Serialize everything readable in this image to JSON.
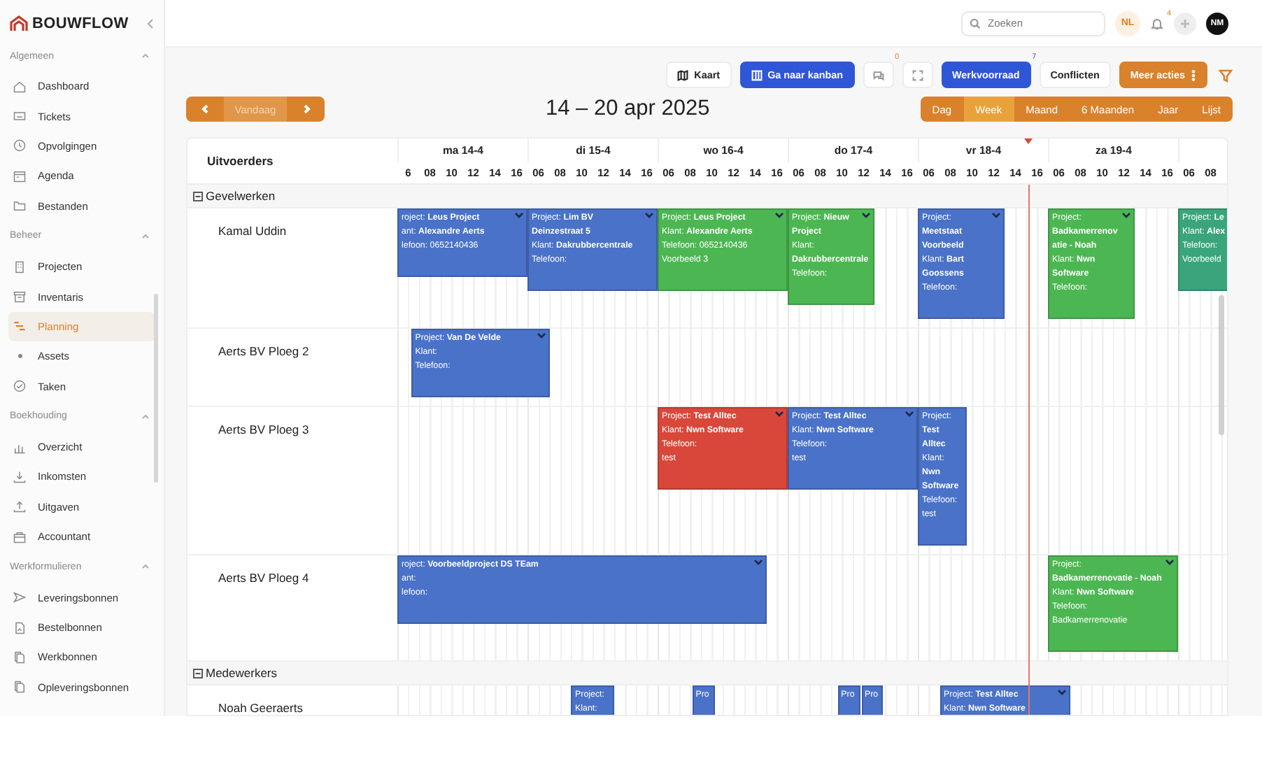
{
  "sidebar": {
    "brand": "BOUWFLOW",
    "sections": [
      {
        "title": "Algemeen",
        "expanded": true,
        "items": [
          {
            "label": "Dashboard",
            "kind": "page",
            "selected": false
          },
          {
            "label": "Tickets",
            "kind": "page",
            "selected": false
          },
          {
            "label": "Opvolgingen",
            "kind": "page",
            "selected": false
          },
          {
            "label": "Agenda",
            "kind": "page",
            "selected": false
          },
          {
            "label": "Bestanden",
            "kind": "page",
            "selected": false
          }
        ]
      },
      {
        "title": "Beheer",
        "expanded": true,
        "items": [
          {
            "label": "Projecten",
            "kind": "page",
            "selected": false
          },
          {
            "label": "Inventaris",
            "kind": "page",
            "selected": false
          },
          {
            "label": "Planning",
            "kind": "page",
            "selected": true
          },
          {
            "label": "Assets",
            "kind": "subitem",
            "selected": false
          },
          {
            "label": "Taken",
            "kind": "page",
            "selected": false
          }
        ]
      },
      {
        "title": "Boekhouding",
        "expanded": true,
        "items": [
          {
            "label": "Overzicht",
            "kind": "page",
            "selected": false
          },
          {
            "label": "Inkomsten",
            "kind": "page",
            "selected": false
          },
          {
            "label": "Uitgaven",
            "kind": "page",
            "selected": false
          },
          {
            "label": "Accountant",
            "kind": "page",
            "selected": false
          }
        ]
      },
      {
        "title": "Werkformulieren",
        "expanded": true,
        "items": [
          {
            "label": "Leveringsbonnen",
            "kind": "page",
            "selected": false
          },
          {
            "label": "Bestelbonnen",
            "kind": "page",
            "selected": false
          },
          {
            "label": "Werkbonnen",
            "kind": "page",
            "selected": false
          },
          {
            "label": "Opleveringsbonnen",
            "kind": "page",
            "selected": false
          }
        ]
      }
    ]
  },
  "header": {
    "search": {
      "placeholder": "Zoeken"
    },
    "language": "NL",
    "notifications": {
      "count": "4"
    },
    "avatar": "NM"
  },
  "toolbar": {
    "map_button": "Kaart",
    "kanban_button": "Ga naar kanban",
    "comments": {
      "count": "0"
    },
    "backlog_button": {
      "label": "Werkvoorraad",
      "count": "7"
    },
    "conflicts_button": "Conflicten",
    "more_button": "Meer acties"
  },
  "navigation": {
    "today": "Vandaag",
    "range_title": "14 – 20 apr 2025"
  },
  "views": [
    {
      "label": "Dag",
      "selected": false
    },
    {
      "label": "Week",
      "selected": true
    },
    {
      "label": "Maand",
      "selected": false
    },
    {
      "label": "6 Maanden",
      "selected": false
    },
    {
      "label": "Jaar",
      "selected": false
    },
    {
      "label": "Lijst",
      "selected": false
    }
  ],
  "calendar": {
    "resource_header": "Uitvoerders",
    "days": [
      {
        "label": "ma 14-4",
        "hours": [
          "6",
          "08",
          "10",
          "12",
          "14",
          "16"
        ]
      },
      {
        "label": "di 15-4",
        "hours": [
          "06",
          "08",
          "10",
          "12",
          "14",
          "16"
        ]
      },
      {
        "label": "wo 16-4",
        "hours": [
          "06",
          "08",
          "10",
          "12",
          "14",
          "16"
        ]
      },
      {
        "label": "do 17-4",
        "hours": [
          "06",
          "08",
          "10",
          "12",
          "14",
          "16"
        ]
      },
      {
        "label": "vr 18-4",
        "hours": [
          "06",
          "08",
          "10",
          "12",
          "14",
          "16"
        ]
      },
      {
        "label": "za 19-4",
        "hours": [
          "06",
          "08",
          "10",
          "12",
          "14",
          "16"
        ]
      },
      {
        "hours": [
          "06",
          "08"
        ]
      }
    ],
    "groups": [
      {
        "label": "Gevelwerken",
        "expanded": true,
        "rows": [
          {
            "name": "Kamal Uddin",
            "events": [
              {
                "color": "#4a72c8",
                "lines": [
                  "roject: **Leus Project**",
                  "ant: **Alexandre Aerts**",
                  "lefoon: 0652140436"
                ]
              },
              {
                "color": "#4a72c8",
                "lines": [
                  "Project: **Lim BV Deinzestraat 5**",
                  "Klant: **Dakrubbercentrale**",
                  "Telefoon:"
                ]
              },
              {
                "color": "#4cb752",
                "lines": [
                  "Project: **Leus Project**",
                  "Klant: **Alexandre Aerts**",
                  "Telefoon: 0652140436",
                  "Voorbeeld 3"
                ]
              },
              {
                "color": "#4cb752",
                "lines": [
                  "Project: **Nieuw Project**",
                  "Klant: **Dakrubbercentrale**",
                  "Telefoon:"
                ]
              },
              {
                "color": "#4a72c8",
                "lines": [
                  "Project: **Meetstaat Voorbeeld**",
                  "Klant: **Bart Goossens**",
                  "Telefoon:"
                ]
              },
              {
                "color": "#4cb752",
                "lines": [
                  "Project: **Badkamerrenovatie - Noah**",
                  "Klant: **Nwn Software**",
                  "Telefoon:"
                ]
              },
              {
                "color": "#3aa57c",
                "lines": [
                  "Project: **Le**",
                  "Klant: **Alex**",
                  "Telefoon:",
                  "Voorbeeld"
                ]
              }
            ]
          },
          {
            "name": "Aerts BV Ploeg 2",
            "events": [
              {
                "color": "#4a72c8",
                "lines": [
                  "Project: **Van De Velde**",
                  "Klant:",
                  "Telefoon:"
                ]
              }
            ]
          },
          {
            "name": "Aerts BV Ploeg 3",
            "events": [
              {
                "color": "#d9473a",
                "lines": [
                  "Project: **Test Alltec**",
                  "Klant: **Nwn Software**",
                  "Telefoon:",
                  "test"
                ]
              },
              {
                "color": "#4a72c8",
                "lines": [
                  "Project: **Test Alltec**",
                  "Klant: **Nwn Software**",
                  "Telefoon:",
                  "test"
                ]
              },
              {
                "color": "#4a72c8",
                "lines": [
                  "Project: **Test Alltec**",
                  "Klant: **Nwn Software**",
                  "Telefoon:",
                  "test"
                ]
              }
            ]
          },
          {
            "name": "Aerts BV Ploeg 4",
            "events": [
              {
                "color": "#4a72c8",
                "lines": [
                  "roject: **Voorbeeldproject DS TEam**",
                  "ant:",
                  "lefoon:"
                ]
              },
              {
                "color": "#4cb752",
                "lines": [
                  "Project: **Badkamerrenovatie - Noah**",
                  "Klant: **Nwn Software**",
                  "Telefoon:",
                  "Badkamerrenovatie"
                ]
              }
            ]
          }
        ]
      },
      {
        "label": "Medewerkers",
        "expanded": true,
        "rows": [
          {
            "name": "Noah Geeraerts",
            "events": [
              {
                "color": "#4a72c8",
                "lines": [
                  "Project:",
                  "Klant:"
                ]
              },
              {
                "color": "#4a72c8",
                "lines": [
                  "Pro"
                ]
              },
              {
                "color": "#4a72c8",
                "lines": [
                  "Pro"
                ]
              },
              {
                "color": "#4a72c8",
                "lines": [
                  "Pro"
                ]
              },
              {
                "color": "#4a72c8",
                "lines": [
                  "Project: **Test Alltec**",
                  "Klant: **Nwn Software**"
                ]
              }
            ]
          }
        ]
      }
    ]
  }
}
